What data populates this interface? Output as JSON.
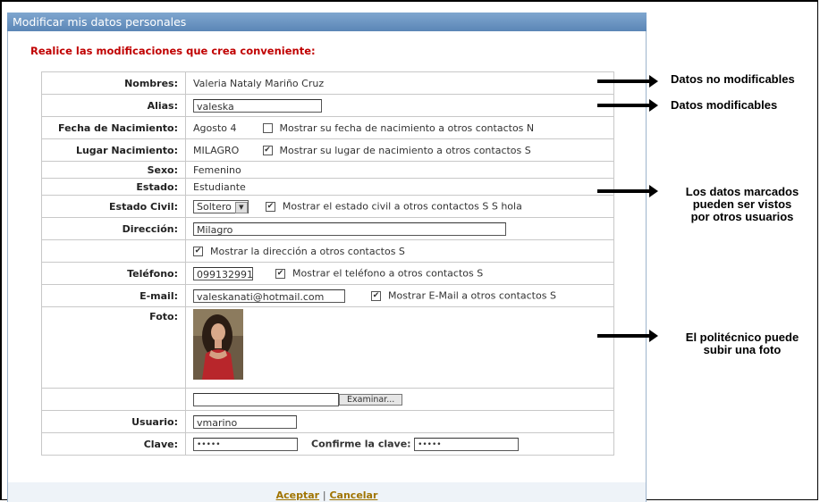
{
  "window": {
    "title": "Modificar mis datos personales"
  },
  "subtitle": "Realice las modificaciones que crea conveniente:",
  "form": {
    "nombres": {
      "label": "Nombres:",
      "value": "Valeria Nataly Mariño Cruz"
    },
    "alias": {
      "label": "Alias:",
      "value": "valeska"
    },
    "fecha": {
      "label": "Fecha de Nacimiento:",
      "value": "Agosto 4",
      "check_label": "Mostrar su fecha de nacimiento a otros contactos N",
      "checked": false
    },
    "lugar": {
      "label": "Lugar Nacimiento:",
      "value": "MILAGRO",
      "check_label": "Mostrar su lugar de nacimiento a otros contactos S",
      "checked": true
    },
    "sexo": {
      "label": "Sexo:",
      "value": "Femenino"
    },
    "estado": {
      "label": "Estado:",
      "value": "Estudiante"
    },
    "estado_civil": {
      "label": "Estado Civil:",
      "selected": "Soltero",
      "check_label": "Mostrar el estado civil a otros contactos S S hola",
      "checked": true
    },
    "direccion": {
      "label": "Dirección:",
      "value": "Milagro",
      "check_label": "Mostrar la dirección a otros contactos S",
      "checked": true
    },
    "telefono": {
      "label": "Teléfono:",
      "value": "099132991",
      "check_label": "Mostrar el teléfono a otros contactos S",
      "checked": true
    },
    "email": {
      "label": "E-mail:",
      "value": "valeskanati@hotmail.com",
      "check_label": "Mostrar E-Mail a otros contactos S",
      "checked": true
    },
    "foto": {
      "label": "Foto:",
      "browse_label": "Examinar..."
    },
    "usuario": {
      "label": "Usuario:",
      "value": "vmarino"
    },
    "clave": {
      "label": "Clave:",
      "value": "•••••",
      "confirm_label": "Confirme la clave:",
      "confirm_value": "•••••"
    }
  },
  "actions": {
    "accept": "Aceptar",
    "separator": "|",
    "cancel": "Cancelar"
  },
  "annotations": {
    "no_modificables": "Datos no modificables",
    "modificables": "Datos modificables",
    "marcados_1": "Los datos marcados",
    "marcados_2": "pueden ser vistos",
    "marcados_3": "por otros usuarios",
    "foto_1": "El politécnico puede",
    "foto_2": "subir una foto"
  },
  "colors": {
    "title_bar": "#6b93c2",
    "subtitle": "#c00000",
    "links": "#a07400"
  }
}
